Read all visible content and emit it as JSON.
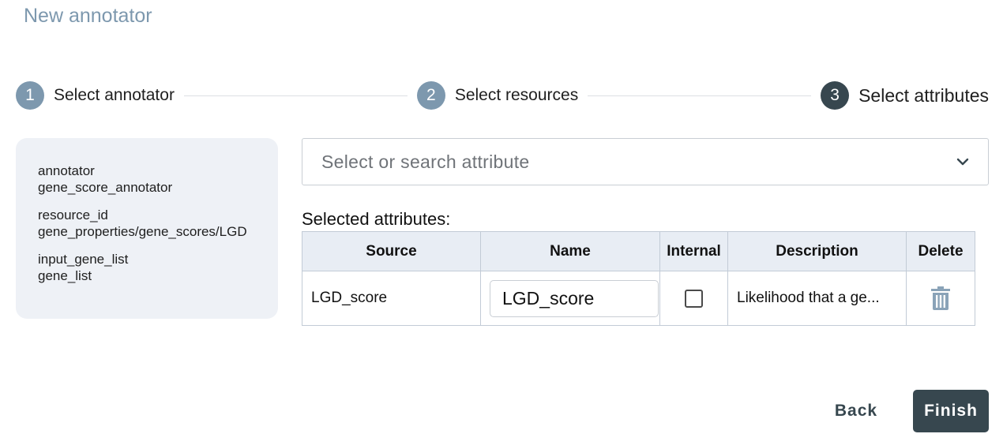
{
  "page": {
    "title": "New annotator"
  },
  "stepper": {
    "steps": [
      {
        "number": "1",
        "label": "Select annotator",
        "active": false
      },
      {
        "number": "2",
        "label": "Select resources",
        "active": false
      },
      {
        "number": "3",
        "label": "Select attributes",
        "active": true
      }
    ]
  },
  "summary": {
    "groups": [
      {
        "key": "annotator",
        "value": "gene_score_annotator"
      },
      {
        "key": "resource_id",
        "value": "gene_properties/gene_scores/LGD"
      },
      {
        "key": "input_gene_list",
        "value": "gene_list"
      }
    ]
  },
  "attribute_select": {
    "placeholder": "Select or search attribute",
    "icon": "chevron-down-icon"
  },
  "selected_attributes": {
    "heading": "Selected attributes:",
    "columns": [
      "Source",
      "Name",
      "Internal",
      "Description",
      "Delete"
    ],
    "rows": [
      {
        "source": "LGD_score",
        "name": "LGD_score",
        "internal": false,
        "description": "Likelihood that a ge...",
        "delete_icon": "trash-icon"
      }
    ]
  },
  "actions": {
    "back": "Back",
    "finish": "Finish"
  },
  "colors": {
    "primary": "#37474f",
    "step_inactive": "#7d98ae",
    "header_bg": "#e8edf4",
    "summary_bg": "#eef1f6"
  }
}
